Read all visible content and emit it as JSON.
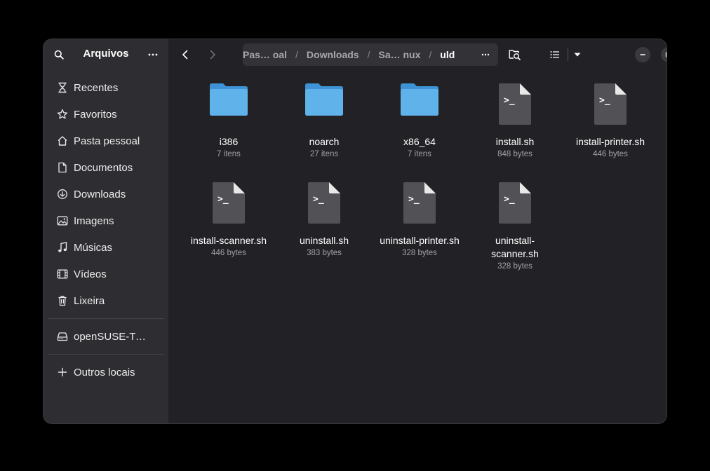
{
  "sidebar": {
    "title": "Arquivos",
    "items": [
      {
        "label": "Recentes",
        "icon": "clock-icon"
      },
      {
        "label": "Favoritos",
        "icon": "star-icon"
      },
      {
        "label": "Pasta pessoal",
        "icon": "home-icon"
      },
      {
        "label": "Documentos",
        "icon": "document-icon"
      },
      {
        "label": "Downloads",
        "icon": "download-icon"
      },
      {
        "label": "Imagens",
        "icon": "image-icon"
      },
      {
        "label": "Músicas",
        "icon": "music-icon"
      },
      {
        "label": "Vídeos",
        "icon": "video-icon"
      },
      {
        "label": "Lixeira",
        "icon": "trash-icon"
      }
    ],
    "drives": [
      {
        "label": "openSUSE-Tu…",
        "icon": "drive-icon"
      }
    ],
    "other": {
      "label": "Outros locais",
      "icon": "plus-icon"
    }
  },
  "pathbar": {
    "crumbs": [
      "Pas… oal",
      "Downloads",
      "Sa…  nux",
      "uld"
    ],
    "separator": "/"
  },
  "files": [
    {
      "name": "i386",
      "meta": "7 itens",
      "type": "folder"
    },
    {
      "name": "noarch",
      "meta": "27 itens",
      "type": "folder"
    },
    {
      "name": "x86_64",
      "meta": "7 itens",
      "type": "folder"
    },
    {
      "name": "install.sh",
      "meta": "848 bytes",
      "type": "script"
    },
    {
      "name": "install-printer.sh",
      "meta": "446 bytes",
      "type": "script"
    },
    {
      "name": "install-scanner.sh",
      "meta": "446 bytes",
      "type": "script"
    },
    {
      "name": "uninstall.sh",
      "meta": "383 bytes",
      "type": "script"
    },
    {
      "name": "uninstall-printer.sh",
      "meta": "328 bytes",
      "type": "script"
    },
    {
      "name": "uninstall-scanner.sh",
      "meta": "328 bytes",
      "type": "script"
    }
  ],
  "colors": {
    "folder": "#5fb3ea",
    "folder_tab": "#3d93d6",
    "sidebar_bg": "#2e2e32",
    "content_bg": "#222226",
    "pathbar_bg": "#333337"
  }
}
